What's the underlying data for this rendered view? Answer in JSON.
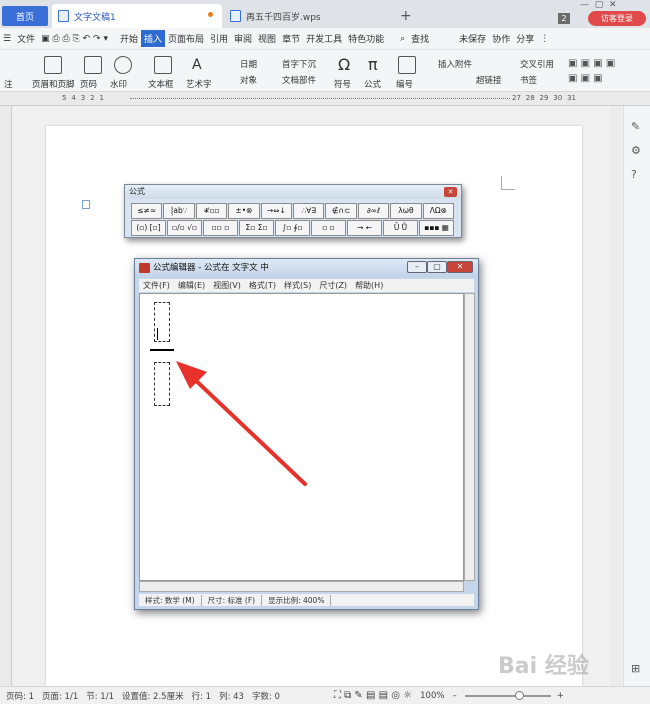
{
  "tabs": {
    "home": "首页",
    "doc1": "文字文稿1",
    "doc2": "再五千四百岁.wps",
    "badge": "2",
    "login": "访客登录"
  },
  "menubar": {
    "file": "文件",
    "items": [
      "开始",
      "插入",
      "页面布局",
      "引用",
      "审阅",
      "视图",
      "章节",
      "开发工具",
      "特色功能"
    ],
    "active_index": 1,
    "search": "查找",
    "unsaved": "未保存",
    "collab": "协作",
    "share": "分享"
  },
  "ribbon": {
    "items": [
      "注",
      "页眉和页脚",
      "页码",
      "水印",
      "文本框",
      "艺术字",
      "对象",
      "文档部件",
      "符号",
      "公式",
      "编号",
      "插入附件",
      "超链接",
      "书签"
    ],
    "date": "日期",
    "dropcap": "首字下沉",
    "crossref": "交叉引用"
  },
  "ruler": {
    "left": [
      "5",
      "4",
      "3",
      "2",
      "1"
    ],
    "right": [
      "27",
      "28",
      "29",
      "30",
      "31"
    ]
  },
  "palette": {
    "title": "公式",
    "row1": [
      "≤≠≈",
      "⸾ab∵",
      "∗⃗▫▫",
      "±•⊗",
      "→⇔↓",
      "∴∀∃",
      "∉∩⊂",
      "∂∞ℓ",
      "λωθ",
      "ΛΩ⊗"
    ],
    "row2": [
      "(▫) [▫]",
      "▫/▫ √▫",
      "▫▫ ▫",
      "Σ▫ Σ▫",
      "∫▫ ∮▫",
      "▫ ▫",
      "→ ←",
      "Ū Ů",
      "▪▪▪ ▦"
    ]
  },
  "editor": {
    "title": "公式编辑器 - 公式在 文字文 中",
    "menu": [
      "文件(F)",
      "编辑(E)",
      "视图(V)",
      "格式(T)",
      "样式(S)",
      "尺寸(Z)",
      "帮助(H)"
    ],
    "status": [
      "样式: 数学 (M)",
      "尺寸: 标准 (F)",
      "显示比例: 400%"
    ]
  },
  "statusbar": {
    "page": "页码: 1",
    "pages": "页面: 1/1",
    "section": "节: 1/1",
    "setting": "设置值: 2.5厘米",
    "row": "行: 1",
    "col": "列: 43",
    "words": "字数: 0",
    "zoom": "100%"
  },
  "watermark": "Bai 经验",
  "colors": {
    "accent": "#2e6bd1",
    "arrow": "#e8312b",
    "login": "#e04a4a"
  }
}
